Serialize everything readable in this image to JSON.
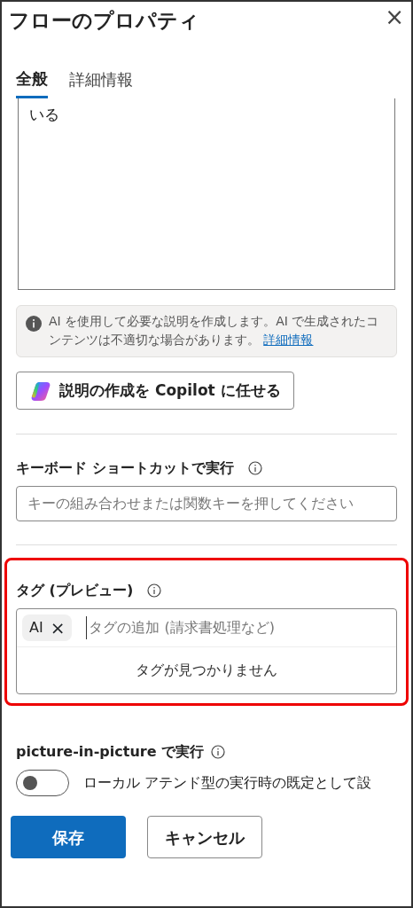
{
  "panel": {
    "title": "フローのプロパティ",
    "close": "×"
  },
  "tabs": [
    {
      "label": "全般",
      "selected": true
    },
    {
      "label": "詳細情報",
      "selected": false
    }
  ],
  "description": {
    "value": "いる"
  },
  "ai_notice": {
    "text": "AI を使用して必要な説明を作成します。AI で生成されたコンテンツは不適切な場合があります。",
    "link": "詳細情報"
  },
  "copilot_button": {
    "label": "説明の作成を Copilot に任せる"
  },
  "shortcut": {
    "label": "キーボード ショートカットで実行",
    "placeholder": "キーの組み合わせまたは関数キーを押してください"
  },
  "tags": {
    "label": "タグ (プレビュー)",
    "highlighted": true,
    "chips": [
      {
        "label": "AI",
        "remove": "×"
      }
    ],
    "placeholder": "タグの追加 (請求書処理など)",
    "empty_message": "タグが見つかりません"
  },
  "pip": {
    "label": "picture-in-picture で実行",
    "toggle_label": "ローカル アテンド型の実行時の既定として設",
    "on": false
  },
  "buttons": [
    {
      "label": "保存",
      "kind": "primary"
    },
    {
      "label": "キャンセル",
      "kind": "secondary"
    }
  ]
}
